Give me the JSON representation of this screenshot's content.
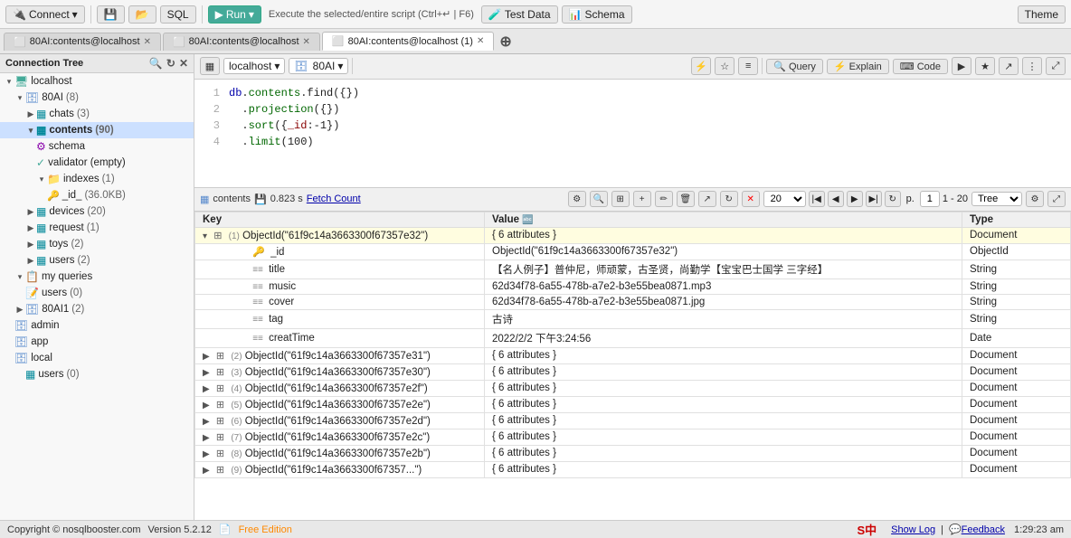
{
  "toolbar": {
    "connect_label": "Connect",
    "run_label": "Run",
    "run_tooltip": "Execute the selected/entire script (Ctrl+↵ | F6)",
    "test_data_label": "Test Data",
    "schema_label": "Schema",
    "theme_label": "Theme",
    "sql_label": "SQL"
  },
  "tabs": [
    {
      "id": "tab1",
      "label": "80AI:contents@localhost",
      "active": false
    },
    {
      "id": "tab2",
      "label": "80AI:contents@localhost",
      "active": false
    },
    {
      "id": "tab3",
      "label": "80AI:contents@localhost (1)",
      "active": true
    }
  ],
  "sidebar": {
    "title": "Connection Tree",
    "items": [
      {
        "id": "localhost",
        "label": "localhost",
        "level": 0,
        "type": "server",
        "expanded": true
      },
      {
        "id": "80AI",
        "label": "80AI",
        "count": "(8)",
        "level": 1,
        "type": "db",
        "expanded": true
      },
      {
        "id": "chats",
        "label": "chats",
        "count": "(3)",
        "level": 2,
        "type": "collection"
      },
      {
        "id": "contents",
        "label": "contents",
        "count": "(90)",
        "level": 2,
        "type": "collection",
        "selected": true,
        "bold": true
      },
      {
        "id": "schema",
        "label": "schema",
        "level": 3,
        "type": "schema"
      },
      {
        "id": "validator",
        "label": "validator (empty)",
        "level": 3,
        "type": "validator"
      },
      {
        "id": "indexes",
        "label": "indexes",
        "count": "(1)",
        "level": 3,
        "type": "folder",
        "expanded": true
      },
      {
        "id": "_id",
        "label": "_id_",
        "extra": "(36.0KB)",
        "level": 4,
        "type": "index"
      },
      {
        "id": "devices",
        "label": "devices",
        "count": "(20)",
        "level": 2,
        "type": "collection"
      },
      {
        "id": "request",
        "label": "request",
        "count": "(1)",
        "level": 2,
        "type": "collection"
      },
      {
        "id": "toys",
        "label": "toys",
        "count": "(2)",
        "level": 2,
        "type": "collection"
      },
      {
        "id": "users",
        "label": "users",
        "count": "(2)",
        "level": 2,
        "type": "collection"
      },
      {
        "id": "myqueries",
        "label": "my queries",
        "level": 1,
        "type": "folder",
        "expanded": true
      },
      {
        "id": "users2",
        "label": "users",
        "count": "(0)",
        "level": 2,
        "type": "query"
      },
      {
        "id": "80AI1",
        "label": "80AI1",
        "count": "(2)",
        "level": 1,
        "type": "db"
      },
      {
        "id": "admin",
        "label": "admin",
        "level": 1,
        "type": "db"
      },
      {
        "id": "app",
        "label": "app",
        "level": 1,
        "type": "db"
      },
      {
        "id": "local",
        "label": "local",
        "level": 1,
        "type": "db"
      },
      {
        "id": "users3",
        "label": "users",
        "count": "(0)",
        "level": 2,
        "type": "collection"
      }
    ]
  },
  "editor": {
    "db_label": "localhost",
    "collection_label": "80AI",
    "lines": [
      {
        "num": 1,
        "code": "db.contents.find({})"
      },
      {
        "num": 2,
        "code": "  .projection({})"
      },
      {
        "num": 3,
        "code": "  .sort({_id:-1})"
      },
      {
        "num": 4,
        "code": "  .limit(100)"
      }
    ],
    "buttons": [
      "Query",
      "Explain",
      "Code"
    ]
  },
  "results": {
    "collection_label": "contents",
    "time_label": "0.823 s",
    "fetch_count_label": "Fetch Count",
    "page_size": "20",
    "page_range": "1 - 20",
    "view_mode": "Tree",
    "columns": [
      "Key",
      "Value",
      "Type"
    ],
    "expanded_row": {
      "id": "(1) ObjectId(\"61f9c14a3663300f67357e32\")",
      "value": "{ 6 attributes }",
      "type": "Document",
      "fields": [
        {
          "key": "_id",
          "value": "ObjectId(\"61f9c14a3663300f67357e32\")",
          "type": "ObjectId"
        },
        {
          "key": "title",
          "value": "【名人例子】普仲尼，师顽蒙，古圣贤，尚勤学【宝宝巴士国学 三字经】",
          "type": "String"
        },
        {
          "key": "music",
          "value": "62d34f78-6a55-478b-a7e2-b3e55bea0871.mp3",
          "type": "String"
        },
        {
          "key": "cover",
          "value": "62d34f78-6a55-478b-a7e2-b3e55bea0871.jpg",
          "type": "String"
        },
        {
          "key": "tag",
          "value": "古诗",
          "type": "String"
        },
        {
          "key": "creatTime",
          "value": "2022/2/2 下午3:24:56",
          "type": "Date"
        }
      ]
    },
    "rows": [
      {
        "id": "(2) ObjectId(\"61f9c14a3663300f67357e31\")",
        "value": "{ 6 attributes }",
        "type": "Document"
      },
      {
        "id": "(3) ObjectId(\"61f9c14a3663300f67357e30\")",
        "value": "{ 6 attributes }",
        "type": "Document"
      },
      {
        "id": "(4) ObjectId(\"61f9c14a3663300f67357e2f\")",
        "value": "{ 6 attributes }",
        "type": "Document"
      },
      {
        "id": "(5) ObjectId(\"61f9c14a3663300f67357e2e\")",
        "value": "{ 6 attributes }",
        "type": "Document"
      },
      {
        "id": "(6) ObjectId(\"61f9c14a3663300f67357e2d\")",
        "value": "{ 6 attributes }",
        "type": "Document"
      },
      {
        "id": "(7) ObjectId(\"61f9c14a3663300f67357e2c\")",
        "value": "{ 6 attributes }",
        "type": "Document"
      },
      {
        "id": "(8) ObjectId(\"61f9c14a3663300f67357e2b\")",
        "value": "{ 6 attributes }",
        "type": "Document"
      },
      {
        "id": "(9) ObjectId(\"61f9c14a3663300f67357...\")",
        "value": "{ 6 attributes }",
        "type": "Document"
      }
    ]
  },
  "statusbar": {
    "copyright": "Copyright © nosqlbooster.com",
    "version": "Version 5.2.12",
    "free_edition": "Free Edition",
    "show_log": "Show Log",
    "feedback": "Feedback",
    "time": "1:29:23 am"
  }
}
